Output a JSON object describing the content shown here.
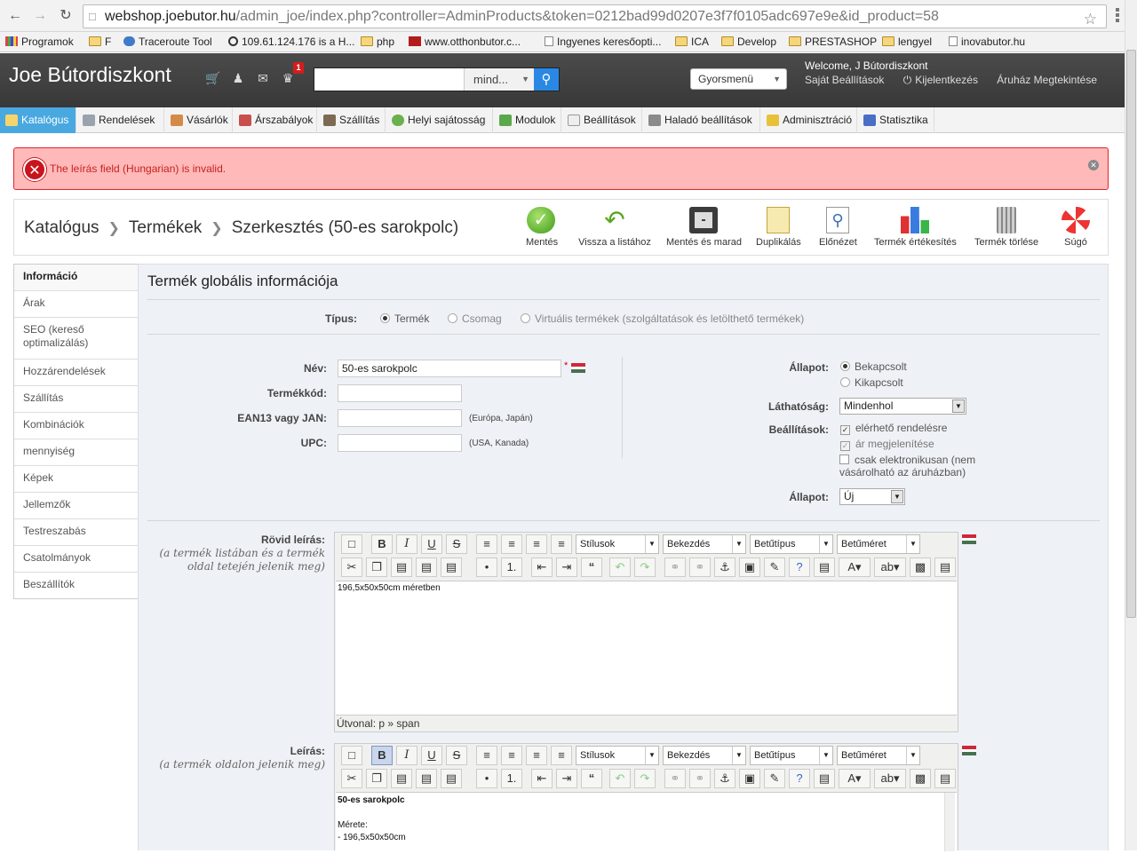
{
  "browser": {
    "url_host": "webshop.joebutor.hu",
    "url_rest": "/admin_joe/index.php?controller=AdminProducts&token=0212bad99d0207e3f7f0105adc697e9e&id_product=58",
    "bookmarks": [
      "Programok",
      "F",
      "Traceroute Tool",
      "109.61.124.176 is a H...",
      "php",
      "www.otthonbutor.c...",
      "Ingyenes keresőopti...",
      "ICA",
      "Develop",
      "PRESTASHOP",
      "lengyel",
      "inovabutor.hu"
    ]
  },
  "header": {
    "shop_name": "Joe Bútordiszkont",
    "badge_count": "1",
    "search_placeholder": "",
    "search_scope": "mind...",
    "quick_menu": "Gyorsmenü",
    "welcome": "Welcome, J Bútordiszkont",
    "links": [
      "Saját Beállítások",
      "Kijelentkezés",
      "Áruház Megtekintése"
    ]
  },
  "tabs": [
    "Katalógus",
    "Rendelések",
    "Vásárlók",
    "Árszabályok",
    "Szállítás",
    "Helyi sajátosság",
    "Modulok",
    "Beállítások",
    "Haladó beállítások",
    "Adminisztráció",
    "Statisztika"
  ],
  "error": {
    "message": "The leírás field (Hungarian) is invalid."
  },
  "breadcrumb": [
    "Katalógus",
    "Termékek",
    "Szerkesztés (50-es sarokpolc)"
  ],
  "toolbar": [
    "Mentés",
    "Vissza a listához",
    "Mentés és marad",
    "Duplikálás",
    "Előnézet",
    "Termék értékesítés",
    "Termék törlése",
    "Súgó"
  ],
  "sidebar": [
    {
      "label": "Információ"
    },
    {
      "label": "Árak"
    },
    {
      "label": "SEO (kereső optimalizálás)"
    },
    {
      "label": "Hozzárendelések"
    },
    {
      "label": "Szállítás"
    },
    {
      "label": "Kombinációk"
    },
    {
      "label": "mennyiség"
    },
    {
      "label": "Képek"
    },
    {
      "label": "Jellemzők"
    },
    {
      "label": "Testreszabás"
    },
    {
      "label": "Csatolmányok"
    },
    {
      "label": "Beszállítók"
    }
  ],
  "form": {
    "title": "Termék globális információja",
    "type_label": "Típus:",
    "type_options": [
      "Termék",
      "Csomag",
      "Virtuális termékek (szolgáltatások és letölthető termékek)"
    ],
    "name_label": "Név:",
    "name_value": "50-es sarokpolc",
    "required_mark": "*",
    "ref_label": "Termékkód:",
    "ref_value": "",
    "ean_label": "EAN13 vagy JAN:",
    "ean_hint": "(Európa, Japán)",
    "upc_label": "UPC:",
    "upc_hint": "(USA, Kanada)",
    "status_label": "Állapot:",
    "status_options": [
      "Bekapcsolt",
      "Kikapcsolt"
    ],
    "visibility_label": "Láthatóság:",
    "visibility_value": "Mindenhol",
    "options_label": "Beállítások:",
    "options": [
      "elérhető rendelésre",
      "ár megjelenítése",
      "csak elektronikusan (nem vásárolható az áruházban)"
    ],
    "condition_label": "Állapot:",
    "condition_value": "Új",
    "short_desc_label": "Rövid leírás:",
    "short_desc_hint": "(a termék listában és a termék oldal tetején jelenik meg)",
    "short_desc_text": "196,5x50x50cm méretben",
    "short_desc_path": "Útvonal: p » span",
    "desc_label": "Leírás:",
    "desc_hint": "(a termék oldalon jelenik meg)",
    "desc_title": "50-es sarokpolc",
    "desc_line1": "Mérete:",
    "desc_line2": "- 196,5x50x50cm"
  },
  "editor": {
    "styles": "Stílusok",
    "format": "Bekezdés",
    "font": "Betűtípus",
    "size": "Betűméret"
  }
}
